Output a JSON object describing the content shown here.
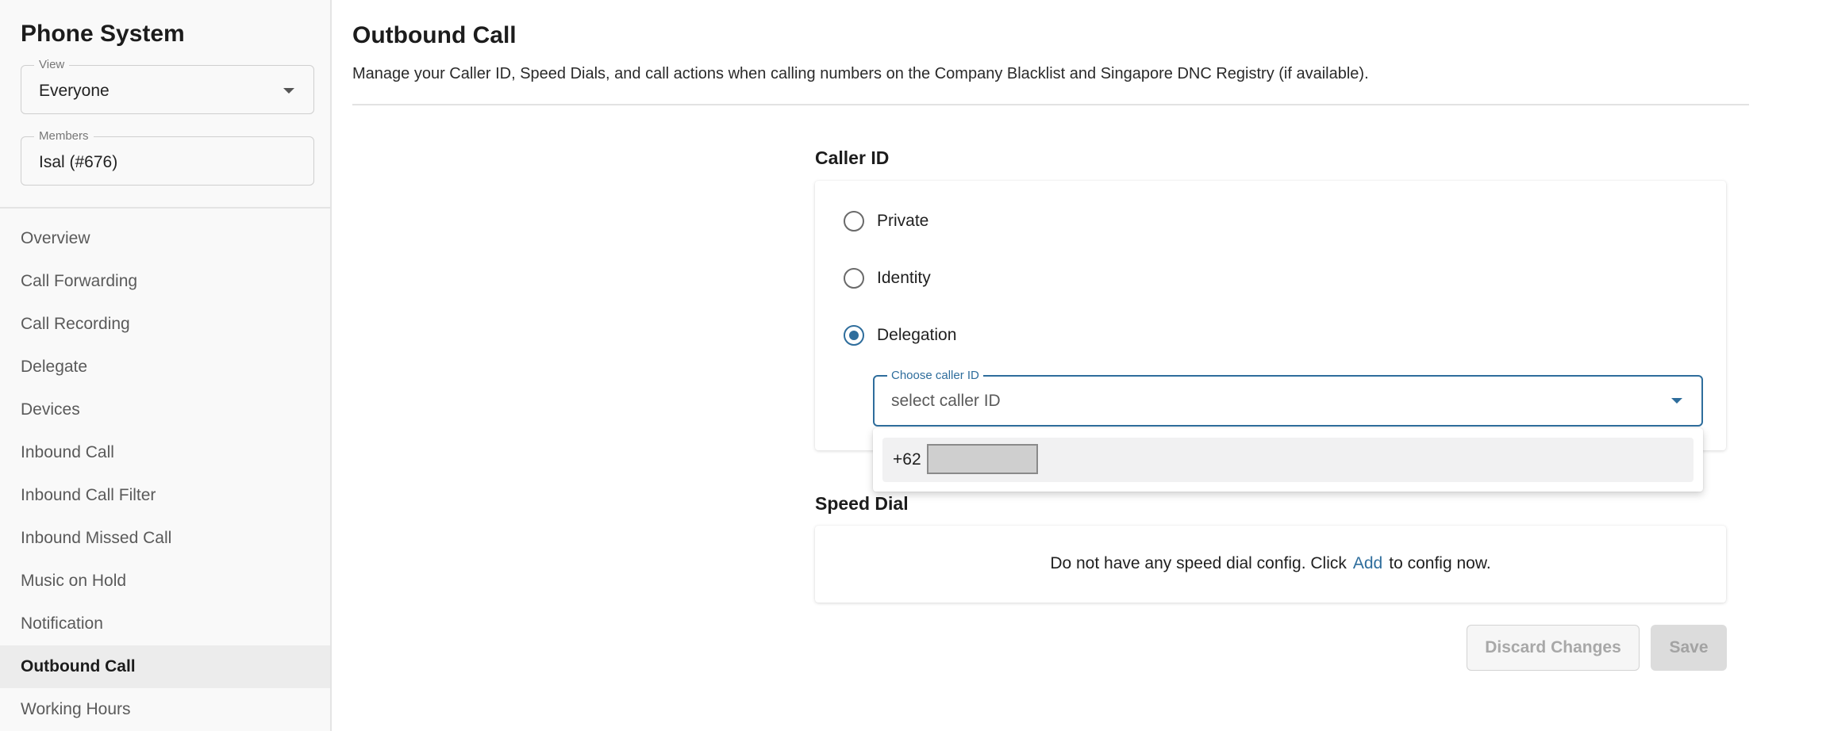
{
  "sidebar": {
    "title": "Phone System",
    "view_field": {
      "legend": "View",
      "value": "Everyone"
    },
    "members_field": {
      "legend": "Members",
      "value": "Isal (#676)"
    },
    "items": [
      {
        "label": "Overview"
      },
      {
        "label": "Call Forwarding"
      },
      {
        "label": "Call Recording"
      },
      {
        "label": "Delegate"
      },
      {
        "label": "Devices"
      },
      {
        "label": "Inbound Call"
      },
      {
        "label": "Inbound Call Filter"
      },
      {
        "label": "Inbound Missed Call"
      },
      {
        "label": "Music on Hold"
      },
      {
        "label": "Notification"
      },
      {
        "label": "Outbound Call"
      },
      {
        "label": "Working Hours"
      }
    ],
    "active_item": "Outbound Call"
  },
  "page": {
    "title": "Outbound Call",
    "description": "Manage your Caller ID, Speed Dials, and call actions when calling numbers on the Company Blacklist and Singapore DNC Registry (if available)."
  },
  "caller_id": {
    "label": "Caller ID",
    "options": [
      {
        "label": "Private",
        "checked": false
      },
      {
        "label": "Identity",
        "checked": false
      },
      {
        "label": "Delegation",
        "checked": true
      }
    ],
    "select": {
      "legend": "Choose caller ID",
      "placeholder": "select caller ID",
      "dropdown_options": [
        "+62"
      ]
    }
  },
  "speed_dial": {
    "label": "Speed Dial",
    "empty_text_before": "Do not have any speed dial config. Click",
    "add_link": "Add",
    "empty_text_after": "to config now."
  },
  "actions": {
    "discard_label": "Discard Changes",
    "save_label": "Save"
  },
  "colors": {
    "accent": "#2e6d9c",
    "sidebar_bg": "#f9f9f9",
    "active_nav_bg": "#ececec",
    "disabled_text": "#a8a8a8"
  },
  "icons": [
    "chevron-down-icon",
    "radio-icon"
  ]
}
